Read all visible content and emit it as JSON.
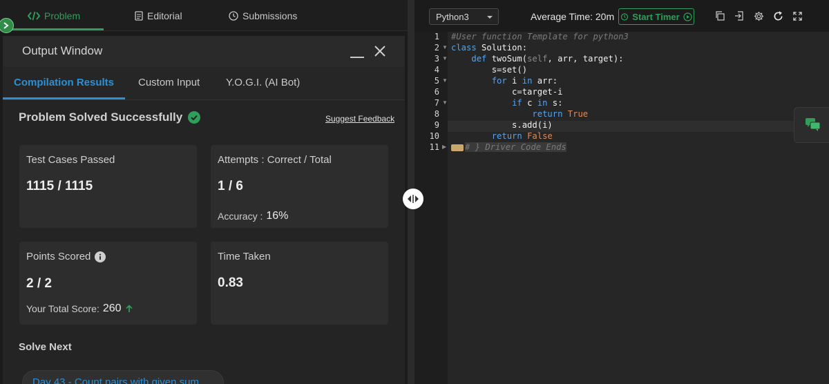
{
  "top_tabs": {
    "problem": "Problem",
    "editorial": "Editorial",
    "submissions": "Submissions"
  },
  "output_window": {
    "title": "Output Window",
    "tabs": [
      "Compilation Results",
      "Custom Input",
      "Y.O.G.I. (AI Bot)"
    ],
    "status": "Problem Solved Successfully",
    "suggest_feedback": "Suggest Feedback",
    "cards": {
      "test_cases_label": "Test Cases Passed",
      "test_cases_value": "1115 / 1115",
      "attempts_label": "Attempts : Correct / Total",
      "attempts_value": "1 / 6",
      "accuracy_label": "Accuracy :",
      "accuracy_value": "16%",
      "points_label": "Points Scored",
      "points_value": "2 / 2",
      "total_score_label": "Your Total Score:",
      "total_score_value": "260",
      "time_label": "Time Taken",
      "time_value": "0.83"
    },
    "solve_next_label": "Solve Next",
    "next_problem": "Day 43 - Count pairs with given sum"
  },
  "editor_toolbar": {
    "language": "Python3",
    "average_time": "Average Time: 20m",
    "start_timer": "Start Timer"
  },
  "code": {
    "line_numbers": [
      "1",
      "2",
      "3",
      "4",
      "5",
      "6",
      "7",
      "8",
      "9",
      "10",
      "11"
    ],
    "l1": "#User function Template for python3",
    "l2_kw": "class",
    "l2_rest": " Solution:",
    "l3_indent": "    ",
    "l3_kw": "def",
    "l3_name": " twoSum(",
    "l3_self": "self",
    "l3_rest": ", arr, target):",
    "l4": "        s=set()",
    "l5_indent": "        ",
    "l5_kw1": "for",
    "l5_mid": " i ",
    "l5_kw2": "in",
    "l5_rest": " arr:",
    "l6": "            c=target-i",
    "l7_indent": "            ",
    "l7_kw1": "if",
    "l7_mid": " c ",
    "l7_kw2": "in",
    "l7_rest": " s:",
    "l8_indent": "                ",
    "l8_kw": "return",
    "l8_val": " True",
    "l9": "            s.add(i)",
    "l10_indent": "        ",
    "l10_kw": "return",
    "l10_val": " False",
    "l11": "# } Driver Code Ends"
  },
  "colors": {
    "accent_green": "#2f9e5a",
    "accent_blue": "#2d8fd5",
    "keyword_blue": "#5ba3e6",
    "literal_orange": "#e08a5a"
  }
}
